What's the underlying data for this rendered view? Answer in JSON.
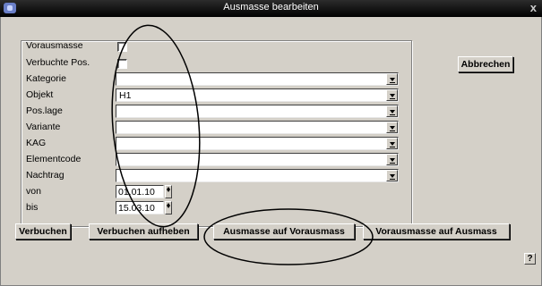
{
  "window": {
    "title": "Ausmasse bearbeiten",
    "close_label": "x"
  },
  "form": {
    "vorausmasse_label": "Vorausmasse",
    "vorausmasse_checked": false,
    "verbuchte_label": "Verbuchte Pos.",
    "verbuchte_checked": false,
    "kategorie_label": "Kategorie",
    "kategorie_value": "",
    "objekt_label": "Objekt",
    "objekt_value": "H1",
    "poslage_label": "Pos.lage",
    "poslage_value": "",
    "variante_label": "Variante",
    "variante_value": "",
    "kag_label": "KAG",
    "kag_value": "",
    "elementcode_label": "Elementcode",
    "elementcode_value": "",
    "nachtrag_label": "Nachtrag",
    "nachtrag_value": "",
    "von_label": "von",
    "von_value": "01.01.10",
    "bis_label": "bis",
    "bis_value": "15.03.10"
  },
  "buttons": {
    "abbrechen": "Abbrechen",
    "verbuchen": "Verbuchen",
    "verbuchen_aufheben": "Verbuchen aufheben",
    "ausmasse_auf_vorausmass": "Ausmasse auf Vorausmass",
    "vorausmasse_auf_ausmass": "Vorausmasse auf Ausmass",
    "help": "?"
  }
}
